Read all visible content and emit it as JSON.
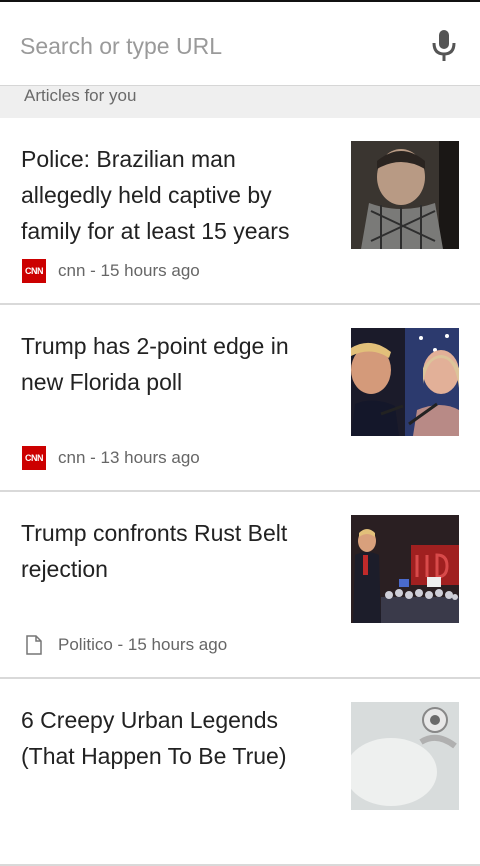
{
  "search": {
    "placeholder": "Search or type URL"
  },
  "section": {
    "title": "Articles for you"
  },
  "articles": [
    {
      "title": "Police: Brazilian man allegedly held captive by family for at least 15 years",
      "source_icon": "cnn-logo-icon",
      "source_logo_text": "CNN",
      "source": "cnn - 15 hours ago"
    },
    {
      "title": "Trump has 2-point edge in new Florida poll",
      "source_icon": "cnn-logo-icon",
      "source_logo_text": "CNN",
      "source": "cnn - 13 hours ago"
    },
    {
      "title": "Trump confronts Rust Belt rejection",
      "source_icon": "document-icon",
      "source": "Politico - 15 hours ago"
    },
    {
      "title": "6 Creepy Urban Legends (That Happen To Be True)"
    }
  ],
  "colors": {
    "cnn_red": "#cc0000",
    "card_bg": "#ffffff",
    "page_bg": "#f2f2f2"
  }
}
